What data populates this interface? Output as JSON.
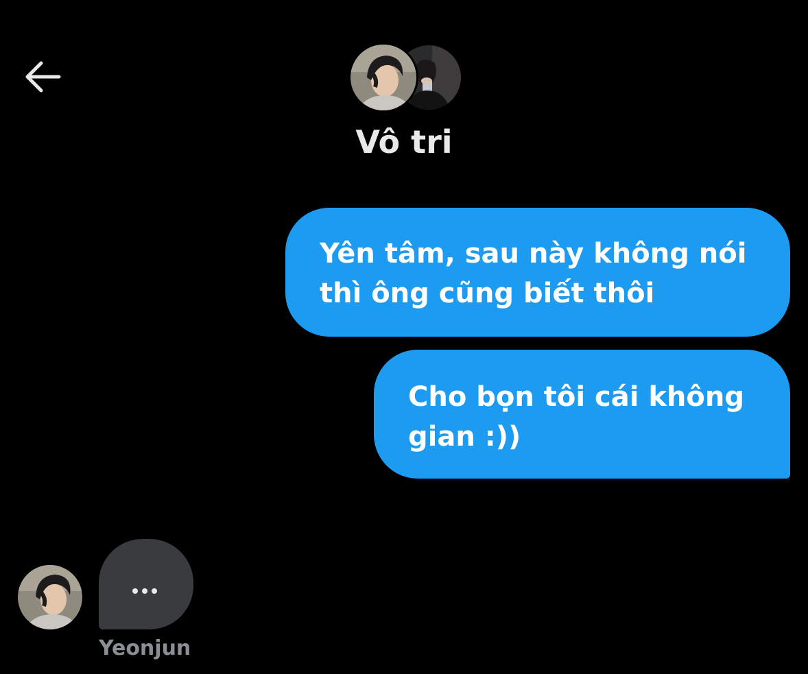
{
  "header": {
    "back_icon": "arrow-left-icon",
    "title": "Vô tri",
    "avatars": [
      "profile-photo-front",
      "profile-photo-back"
    ]
  },
  "messages": [
    {
      "direction": "outgoing",
      "text": "Yên tâm, sau này không nói\nthì ông cũng biết thôi"
    },
    {
      "direction": "outgoing",
      "text": "Cho bọn tôi cái không\ngian :))"
    }
  ],
  "typing": {
    "sender": "Yeonjun",
    "indicator_icon": "typing-dots-icon"
  },
  "colors": {
    "background": "#000000",
    "outgoing_bubble": "#1d9bf0",
    "typing_bubble": "#3a3b3e",
    "title_text": "#e7e9ea",
    "muted_text": "#8b8f94"
  }
}
